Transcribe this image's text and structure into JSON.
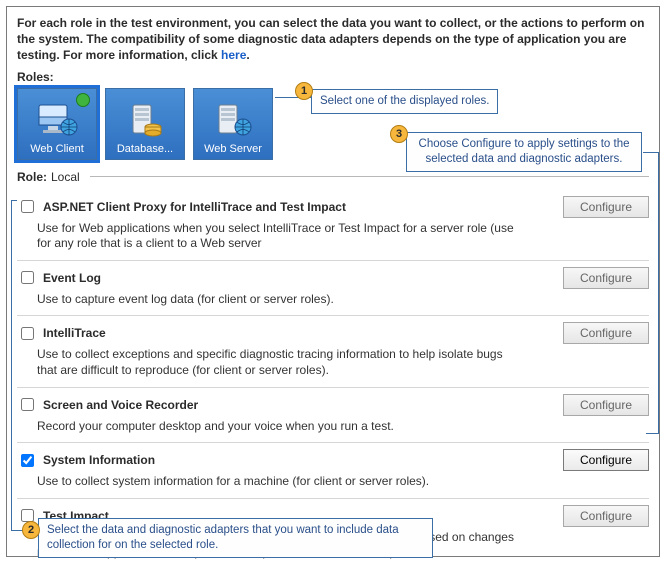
{
  "intro": {
    "text_before": "For each role in the test environment, you can select the data you want to collect, or the actions to perform on the system. The compatibility of some diagnostic data adapters depends on the type of application you are testing. For more information, click ",
    "link": "here",
    "text_after": "."
  },
  "roles_label": "Roles:",
  "roles": [
    {
      "label": "Web Client",
      "selected": true,
      "status": true
    },
    {
      "label": "Database...",
      "selected": false,
      "status": false
    },
    {
      "label": "Web Server",
      "selected": false,
      "status": false
    }
  ],
  "role_line": {
    "label": "Role:",
    "value": "Local"
  },
  "configure_label": "Configure",
  "adapters": [
    {
      "title": "ASP.NET Client Proxy for IntelliTrace and Test Impact",
      "desc": "Use for Web applications when you select IntelliTrace or Test Impact for a server role (use for any role that is a client to a Web server",
      "checked": false
    },
    {
      "title": "Event Log",
      "desc": "Use to capture event log data (for client or server roles).",
      "checked": false
    },
    {
      "title": "IntelliTrace",
      "desc": "Use to collect exceptions and specific diagnostic tracing information to help isolate bugs that are difficult to reproduce (for client or server roles).",
      "checked": false
    },
    {
      "title": "Screen and Voice Recorder",
      "desc": "Record your computer desktop and your voice when you run a test.",
      "checked": false
    },
    {
      "title": "System Information",
      "desc": "Use to collect system information for a machine (for client or server roles).",
      "checked": true
    },
    {
      "title": "Test Impact",
      "desc": "Use to collect information that can help you decide which tests to rerun based on changes made to an application for a specific build (for client or server roles).",
      "checked": false
    }
  ],
  "callouts": {
    "c1": "Select one of the displayed roles.",
    "c2": "Select the data and diagnostic adapters that you want to include data collection for on the selected role.",
    "c3": "Choose Configure to apply settings to the selected data and diagnostic adapters."
  },
  "badges": {
    "b1": "1",
    "b2": "2",
    "b3": "3"
  }
}
